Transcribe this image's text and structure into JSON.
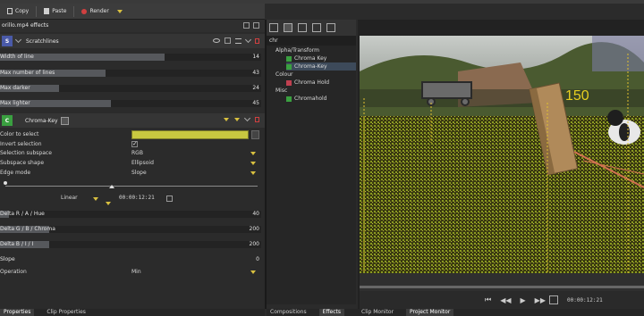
{
  "toolbar": {
    "copy_label": "Copy",
    "paste_label": "Paste",
    "render_label": "Render"
  },
  "effects_panel": {
    "header_title": "orillo.mp4 effects",
    "effect1": {
      "badge": "S",
      "badge_color": "#4a5aa8",
      "name": "Scratchlines",
      "params": [
        {
          "label": "Width of line",
          "value": "14",
          "fill": 0.63
        },
        {
          "label": "Max number of lines",
          "value": "43",
          "fill": 0.4
        },
        {
          "label": "Max darker",
          "value": "24",
          "fill": 0.22
        },
        {
          "label": "Max lighter",
          "value": "45",
          "fill": 0.42
        }
      ]
    },
    "effect2": {
      "badge": "C",
      "badge_color": "#3aa040",
      "name": "Chroma-Key",
      "color_label": "Color to select",
      "color_value": "#c8c840",
      "invert_label": "Invert selection",
      "subspace_label": "Selection subspace",
      "subspace_value": "RGB",
      "shape_label": "Subspace shape",
      "shape_value": "Ellipsoid",
      "edge_label": "Edge mode",
      "edge_value": "Slope",
      "interp_value": "Linear",
      "timecode": "00:00:12:21",
      "deltas": [
        {
          "label": "Delta R / A / Hue",
          "value": "40",
          "fill": 0.03
        },
        {
          "label": "Delta G / B / Chroma",
          "value": "200",
          "fill": 0.19
        },
        {
          "label": "Delta B / I / I",
          "value": "200",
          "fill": 0.19
        }
      ],
      "slope_label": "Slope",
      "slope_value": "0",
      "operation_label": "Operation",
      "operation_value": "Min"
    }
  },
  "effects_browser": {
    "search_value": "chr",
    "groups": [
      {
        "name": "Alpha/Transform"
      },
      {
        "name": "Chroma Key",
        "color": "#3aa040"
      },
      {
        "name": "Chroma-Key",
        "color": "#3aa040",
        "selected": true
      },
      {
        "name": "Colour"
      },
      {
        "name": "Chroma Hold",
        "color": "#c04050"
      },
      {
        "name": "Misc"
      },
      {
        "name": "Chromahold",
        "color": "#3aa040"
      }
    ]
  },
  "monitor": {
    "overlay_text": "150",
    "timecode": "00:00:12:21"
  },
  "bottom_tabs": {
    "left": [
      "Properties",
      "Clip Properties"
    ],
    "middle": [
      "Compositions",
      "Effects"
    ],
    "right": [
      "Clip Monitor",
      "Project Monitor"
    ]
  }
}
